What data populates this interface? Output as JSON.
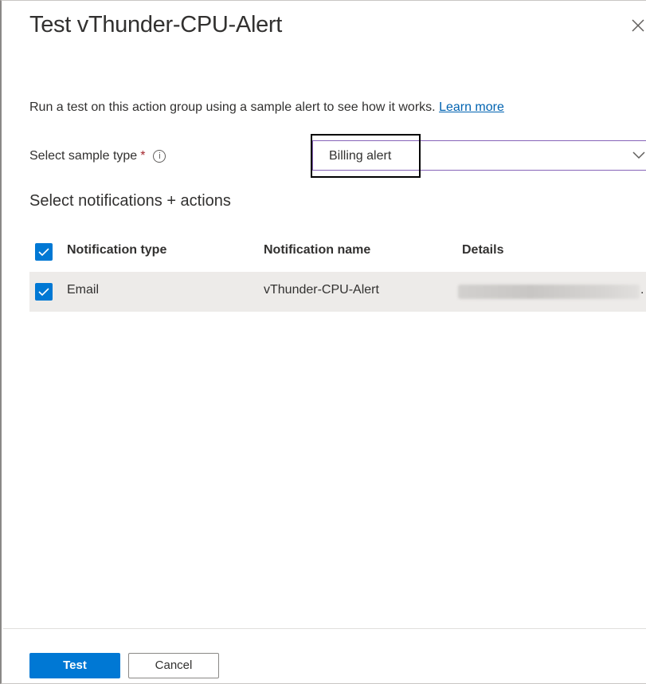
{
  "panel": {
    "title": "Test vThunder-CPU-Alert",
    "close_icon": "close-icon"
  },
  "intro": {
    "text": "Run a test on this action group using a sample alert to see how it works.",
    "link": "Learn more"
  },
  "sample_type": {
    "label": "Select sample type",
    "required_marker": "*",
    "info_icon": "info-icon",
    "info_glyph": "i",
    "selected_value": "Billing alert",
    "dropdown_icon": "chevron-down-icon"
  },
  "notifications": {
    "section_title": "Select notifications + actions",
    "columns": [
      "Notification type",
      "Notification name",
      "Details"
    ],
    "header_checked": true,
    "rows": [
      {
        "checked": true,
        "type": "Email",
        "name": "vThunder-CPU-Alert",
        "details_suffix": "."
      }
    ]
  },
  "footer": {
    "test_label": "Test",
    "cancel_label": "Cancel"
  },
  "colors": {
    "primary": "#0078d4",
    "link": "#0063b1",
    "required": "#a4262c",
    "focus_border": "#8764b8",
    "row_bg": "#edebe9"
  }
}
